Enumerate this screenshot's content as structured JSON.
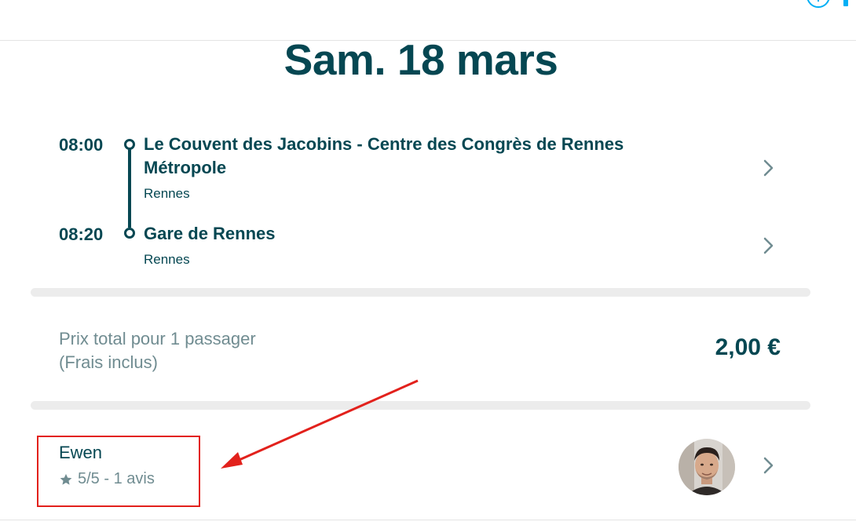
{
  "header": {
    "date": "Sam. 18 mars"
  },
  "itinerary": {
    "stops": [
      {
        "time": "08:00",
        "name_line1": "Le Couvent des Jacobins - Centre des Congrès de Rennes",
        "name_line2": "Métropole",
        "city": "Rennes"
      },
      {
        "time": "08:20",
        "name_line1": "Gare de Rennes",
        "city": "Rennes"
      }
    ]
  },
  "price": {
    "label_line1": "Prix total pour 1 passager",
    "label_line2": "(Frais inclus)",
    "value": "2,00 €"
  },
  "driver": {
    "name": "Ewen",
    "rating": "5/5 - 1 avis"
  },
  "colors": {
    "primary": "#054752",
    "muted": "#708c91",
    "accent": "#00aff5",
    "annotation": "#e2211c",
    "separator": "#ececec"
  },
  "icons": {
    "chevron": "chevron-right-icon",
    "star": "star-icon",
    "plus": "plus-circle-icon"
  }
}
